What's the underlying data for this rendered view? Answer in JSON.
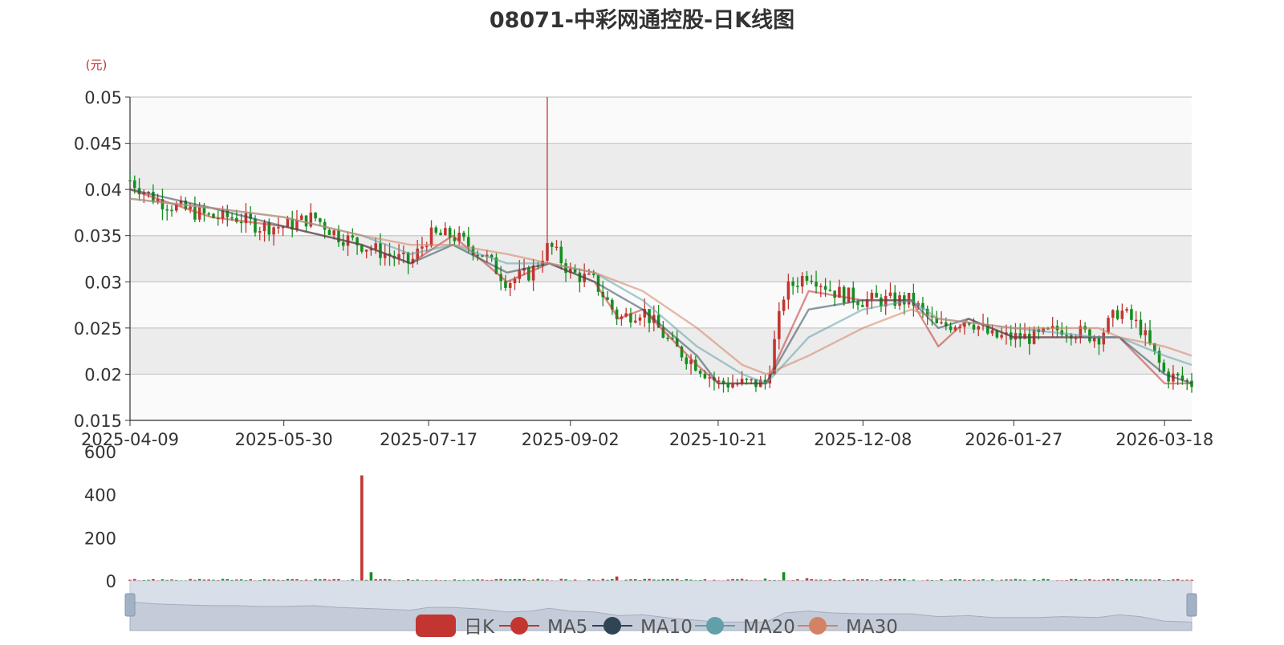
{
  "title": "08071-中彩网通控股-日K线图",
  "price_unit": "(元)",
  "colors": {
    "up": "#c23531",
    "down": "#148f1e",
    "ma5": "#c23531",
    "ma10": "#2f4554",
    "ma20": "#61a0a8",
    "ma30": "#d48265",
    "grid_band": "#ececec",
    "zoom_bg": "#d9dfe9"
  },
  "legend": [
    {
      "name": "日K",
      "icon": "rounded-rect",
      "color": "#c23531"
    },
    {
      "name": "MA5",
      "icon": "circle-line",
      "color": "#c23531"
    },
    {
      "name": "MA10",
      "icon": "circle-line",
      "color": "#2f4554"
    },
    {
      "name": "MA20",
      "icon": "circle-line",
      "color": "#61a0a8"
    },
    {
      "name": "MA30",
      "icon": "circle-line",
      "color": "#d48265"
    }
  ],
  "chart_data": [
    {
      "type": "candlestick",
      "title": "08071-中彩网通控股-日K线图",
      "ylabel": "(元)",
      "ylim": [
        0.015,
        0.05
      ],
      "y_ticks": [
        "0.015",
        "0.02",
        "0.025",
        "0.03",
        "0.035",
        "0.04",
        "0.045",
        "0.05"
      ],
      "x_range": [
        "2025-04-09",
        "2026-03-27"
      ],
      "x_ticks": [
        "2025-04-09",
        "2025-05-30",
        "2025-07-17",
        "2025-09-02",
        "2025-10-21",
        "2025-12-08",
        "2026-01-27",
        "2026-03-18"
      ],
      "grid": "horizontal bands",
      "legend_position": "bottom-center",
      "series": [
        {
          "name": "日K",
          "close_path": [
            [
              "2025-04-09",
              0.041
            ],
            [
              "2025-04-17",
              0.039
            ],
            [
              "2025-04-25",
              0.038
            ],
            [
              "2025-05-06",
              0.037
            ],
            [
              "2025-05-14",
              0.037
            ],
            [
              "2025-05-22",
              0.036
            ],
            [
              "2025-05-30",
              0.036
            ],
            [
              "2025-06-09",
              0.037
            ],
            [
              "2025-06-17",
              0.035
            ],
            [
              "2025-06-25",
              0.034
            ],
            [
              "2025-07-03",
              0.033
            ],
            [
              "2025-07-11",
              0.032
            ],
            [
              "2025-07-17",
              0.035
            ],
            [
              "2025-07-25",
              0.035
            ],
            [
              "2025-08-04",
              0.033
            ],
            [
              "2025-08-12",
              0.03
            ],
            [
              "2025-08-20",
              0.031
            ],
            [
              "2025-08-26",
              0.034
            ],
            [
              "2025-09-02",
              0.031
            ],
            [
              "2025-09-10",
              0.03
            ],
            [
              "2025-09-18",
              0.026
            ],
            [
              "2025-09-26",
              0.027
            ],
            [
              "2025-10-06",
              0.023
            ],
            [
              "2025-10-14",
              0.021
            ],
            [
              "2025-10-21",
              0.019
            ],
            [
              "2025-10-29",
              0.019
            ],
            [
              "2025-11-06",
              0.019
            ],
            [
              "2025-11-12",
              0.029
            ],
            [
              "2025-11-20",
              0.031
            ],
            [
              "2025-11-28",
              0.029
            ],
            [
              "2025-12-08",
              0.028
            ],
            [
              "2025-12-16",
              0.028
            ],
            [
              "2025-12-24",
              0.028
            ],
            [
              "2026-01-02",
              0.025
            ],
            [
              "2026-01-12",
              0.026
            ],
            [
              "2026-01-20",
              0.024
            ],
            [
              "2026-01-27",
              0.024
            ],
            [
              "2026-02-04",
              0.024
            ],
            [
              "2026-02-12",
              0.025
            ],
            [
              "2026-02-24",
              0.024
            ],
            [
              "2026-03-03",
              0.027
            ],
            [
              "2026-03-10",
              0.025
            ],
            [
              "2026-03-18",
              0.02
            ],
            [
              "2026-03-27",
              0.019
            ]
          ]
        },
        {
          "name": "MA5",
          "values": [
            [
              "2025-04-09",
              0.04
            ],
            [
              "2025-05-06",
              0.037
            ],
            [
              "2025-05-30",
              0.036
            ],
            [
              "2025-06-25",
              0.034
            ],
            [
              "2025-07-11",
              0.032
            ],
            [
              "2025-07-25",
              0.035
            ],
            [
              "2025-08-12",
              0.03
            ],
            [
              "2025-08-26",
              0.032
            ],
            [
              "2025-09-10",
              0.03
            ],
            [
              "2025-09-18",
              0.026
            ],
            [
              "2025-09-26",
              0.027
            ],
            [
              "2025-10-14",
              0.021
            ],
            [
              "2025-10-21",
              0.019
            ],
            [
              "2025-11-06",
              0.019
            ],
            [
              "2025-11-20",
              0.029
            ],
            [
              "2025-12-08",
              0.028
            ],
            [
              "2025-12-24",
              0.028
            ],
            [
              "2026-01-02",
              0.023
            ],
            [
              "2026-01-12",
              0.026
            ],
            [
              "2026-01-27",
              0.024
            ],
            [
              "2026-02-12",
              0.024
            ],
            [
              "2026-03-03",
              0.024
            ],
            [
              "2026-03-18",
              0.019
            ],
            [
              "2026-03-27",
              0.019
            ]
          ]
        },
        {
          "name": "MA10",
          "values": [
            [
              "2025-04-09",
              0.04
            ],
            [
              "2025-05-06",
              0.038
            ],
            [
              "2025-05-30",
              0.036
            ],
            [
              "2025-06-25",
              0.034
            ],
            [
              "2025-07-11",
              0.032
            ],
            [
              "2025-07-25",
              0.034
            ],
            [
              "2025-08-12",
              0.031
            ],
            [
              "2025-08-26",
              0.032
            ],
            [
              "2025-09-10",
              0.03
            ],
            [
              "2025-09-26",
              0.027
            ],
            [
              "2025-10-14",
              0.022
            ],
            [
              "2025-10-21",
              0.019
            ],
            [
              "2025-11-06",
              0.019
            ],
            [
              "2025-11-20",
              0.027
            ],
            [
              "2025-12-08",
              0.028
            ],
            [
              "2025-12-24",
              0.028
            ],
            [
              "2026-01-02",
              0.025
            ],
            [
              "2026-01-12",
              0.026
            ],
            [
              "2026-01-27",
              0.024
            ],
            [
              "2026-02-24",
              0.024
            ],
            [
              "2026-03-03",
              0.024
            ],
            [
              "2026-03-18",
              0.02
            ],
            [
              "2026-03-27",
              0.019
            ]
          ]
        },
        {
          "name": "MA20",
          "values": [
            [
              "2025-04-09",
              0.039
            ],
            [
              "2025-05-06",
              0.038
            ],
            [
              "2025-05-30",
              0.037
            ],
            [
              "2025-06-25",
              0.035
            ],
            [
              "2025-07-11",
              0.033
            ],
            [
              "2025-07-25",
              0.034
            ],
            [
              "2025-08-12",
              0.032
            ],
            [
              "2025-08-26",
              0.032
            ],
            [
              "2025-09-10",
              0.031
            ],
            [
              "2025-09-26",
              0.028
            ],
            [
              "2025-10-14",
              0.023
            ],
            [
              "2025-10-29",
              0.02
            ],
            [
              "2025-11-06",
              0.019
            ],
            [
              "2025-11-20",
              0.024
            ],
            [
              "2025-12-08",
              0.027
            ],
            [
              "2025-12-24",
              0.028
            ],
            [
              "2026-01-02",
              0.026
            ],
            [
              "2026-01-27",
              0.025
            ],
            [
              "2026-02-24",
              0.024
            ],
            [
              "2026-03-03",
              0.024
            ],
            [
              "2026-03-18",
              0.022
            ],
            [
              "2026-03-27",
              0.021
            ]
          ]
        },
        {
          "name": "MA30",
          "values": [
            [
              "2025-04-09",
              0.039
            ],
            [
              "2025-05-06",
              0.038
            ],
            [
              "2025-05-30",
              0.037
            ],
            [
              "2025-06-25",
              0.035
            ],
            [
              "2025-07-11",
              0.034
            ],
            [
              "2025-07-25",
              0.034
            ],
            [
              "2025-08-12",
              0.033
            ],
            [
              "2025-08-26",
              0.032
            ],
            [
              "2025-09-10",
              0.031
            ],
            [
              "2025-09-26",
              0.029
            ],
            [
              "2025-10-14",
              0.025
            ],
            [
              "2025-10-29",
              0.021
            ],
            [
              "2025-11-06",
              0.02
            ],
            [
              "2025-11-20",
              0.022
            ],
            [
              "2025-12-08",
              0.025
            ],
            [
              "2025-12-24",
              0.027
            ],
            [
              "2026-01-02",
              0.026
            ],
            [
              "2026-01-27",
              0.025
            ],
            [
              "2026-02-24",
              0.025
            ],
            [
              "2026-03-03",
              0.024
            ],
            [
              "2026-03-18",
              0.023
            ],
            [
              "2026-03-27",
              0.022
            ]
          ]
        }
      ],
      "annotations": [
        {
          "date": "2025-08-26",
          "high": 0.05,
          "note": "spike"
        }
      ]
    },
    {
      "type": "bar",
      "title": "",
      "ylim": [
        0,
        600
      ],
      "y_ticks": [
        "0",
        "200",
        "400",
        "600"
      ],
      "series": [
        {
          "values": [
            [
              "2025-04-09",
              5
            ],
            [
              "2025-04-25",
              4
            ],
            [
              "2025-05-14",
              6
            ],
            [
              "2025-05-30",
              4
            ],
            [
              "2025-06-17",
              8
            ],
            [
              "2025-06-25",
              490
            ],
            [
              "2025-06-28",
              40
            ],
            [
              "2025-07-17",
              4
            ],
            [
              "2025-08-04",
              6
            ],
            [
              "2025-08-26",
              6
            ],
            [
              "2025-09-18",
              20
            ],
            [
              "2025-10-06",
              8
            ],
            [
              "2025-11-06",
              10
            ],
            [
              "2025-11-12",
              40
            ],
            [
              "2025-11-20",
              12
            ],
            [
              "2025-12-16",
              4
            ],
            [
              "2026-01-12",
              4
            ],
            [
              "2026-02-12",
              3
            ],
            [
              "2026-03-10",
              6
            ],
            [
              "2026-03-27",
              5
            ]
          ]
        }
      ]
    }
  ]
}
